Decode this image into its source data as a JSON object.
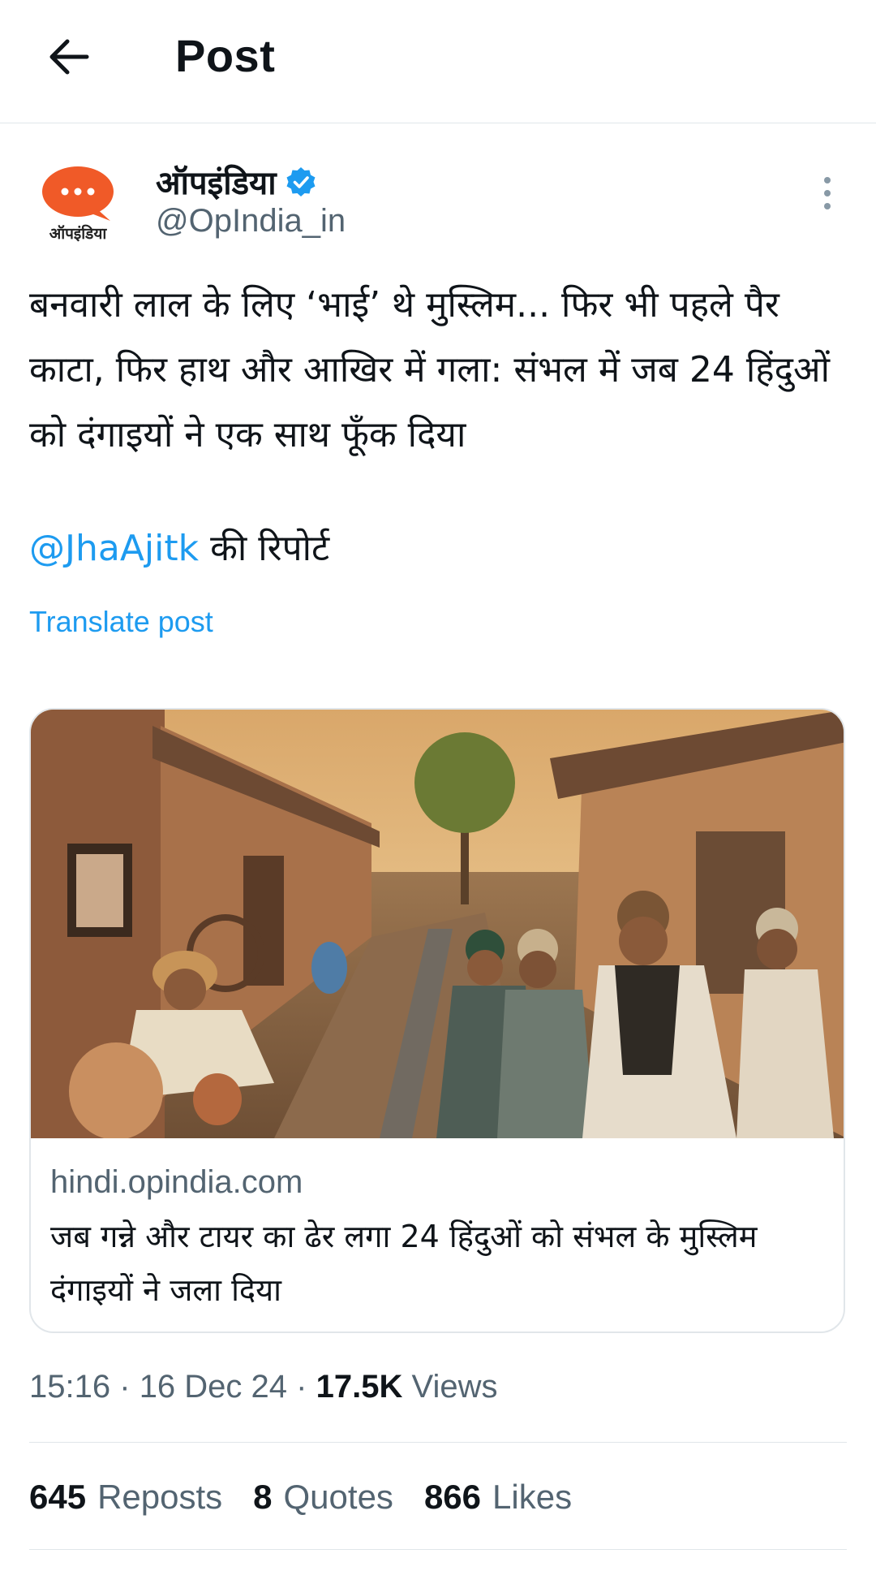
{
  "header": {
    "title": "Post"
  },
  "author": {
    "name": "ऑपइंडिया",
    "handle": "@OpIndia_in",
    "avatar_text": "ऑपइंडिया",
    "verified": true
  },
  "post": {
    "text": "बनवारी लाल के लिए ‘भाई’ थे मुस्लिम... फिर भी पहले पैर काटा, फिर हाथ और आखिर में गला: संभल में जब 24 हिंदुओं को दंगाइयों ने एक साथ फूँक दिया",
    "mention": "@JhaAjitk",
    "mention_suffix": " की रिपोर्ट",
    "translate_label": "Translate post"
  },
  "card": {
    "domain": "hindi.opindia.com",
    "title": "जब गन्ने और टायर का ढेर लगा 24 हिंदुओं को संभल के मुस्लिम दंगाइयों ने जला दिया"
  },
  "meta": {
    "time": "15:16",
    "date": "16 Dec 24",
    "views_count": "17.5K",
    "views_label": "Views",
    "separator": "·"
  },
  "stats": {
    "reposts_count": "645",
    "reposts_label": "Reposts",
    "quotes_count": "8",
    "quotes_label": "Quotes",
    "likes_count": "866",
    "likes_label": "Likes"
  },
  "colors": {
    "accent": "#1d9bf0",
    "secondary_text": "#536471",
    "avatar_orange": "#f05a28",
    "divider": "#e1e6ea"
  },
  "icons": {
    "back": "arrow-left-icon",
    "verified": "verified-badge-icon",
    "more": "more-vertical-icon"
  }
}
